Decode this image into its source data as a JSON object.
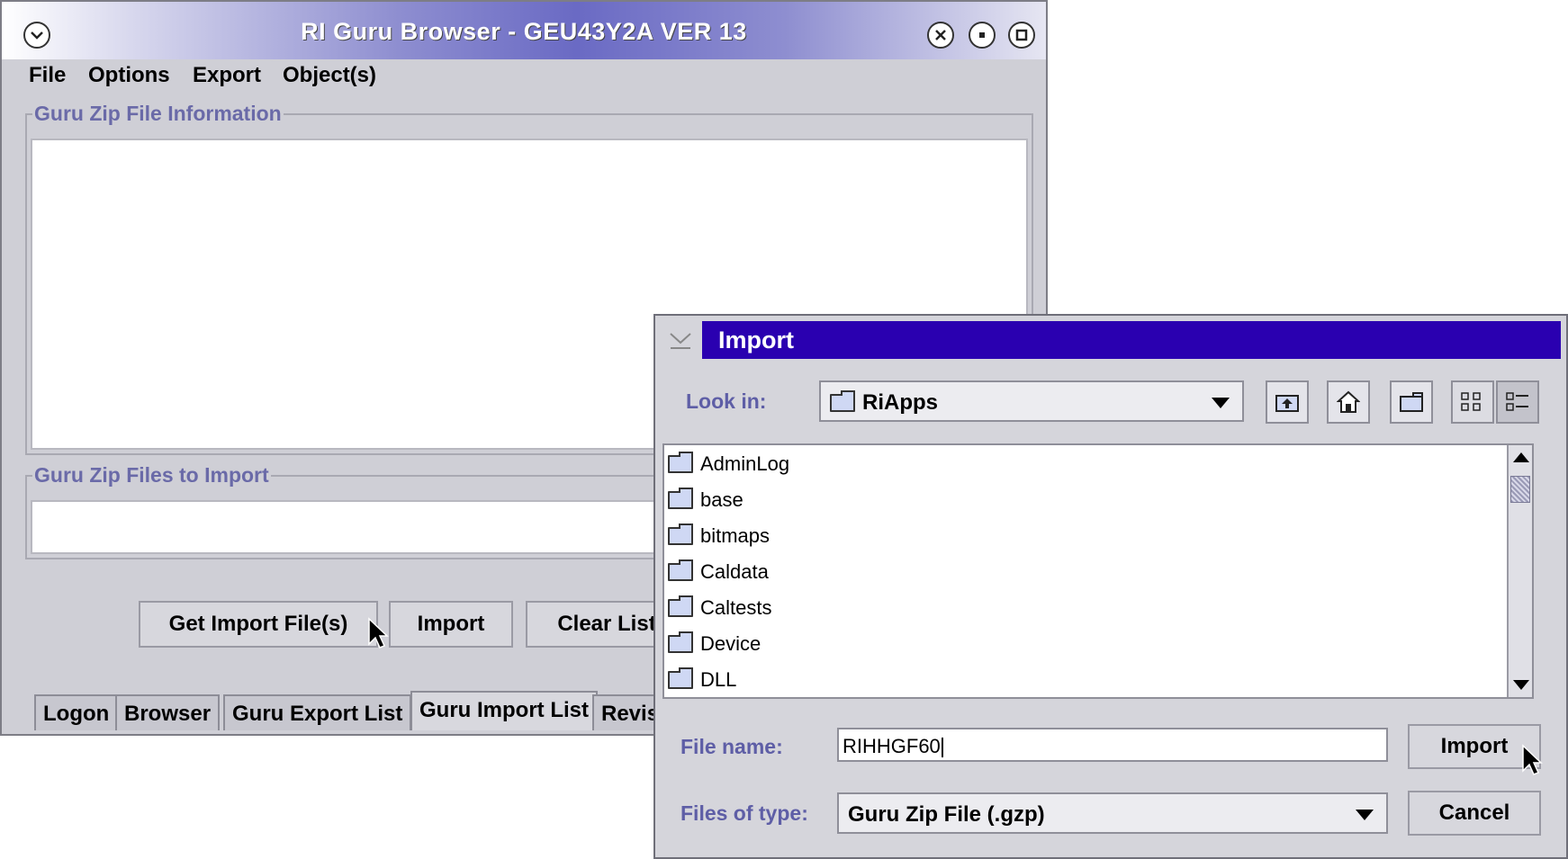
{
  "main_window": {
    "title": "RI Guru Browser - GEU43Y2A  VER 13",
    "menu": [
      "File",
      "Options",
      "Export",
      "Object(s)"
    ],
    "group_info_title": "Guru Zip File Information",
    "group_files_title": "Guru Zip Files to Import",
    "buttons": {
      "get_import": "Get Import File(s)",
      "import": "Import",
      "clear_list": "Clear List"
    },
    "tabs": [
      "Logon",
      "Browser",
      "Guru Export List",
      "Guru Import List",
      "Revis"
    ],
    "active_tab": "Guru Import List"
  },
  "import_dialog": {
    "title": "Import",
    "look_in_label": "Look in:",
    "look_in_value": "RiApps",
    "files": [
      "AdminLog",
      "base",
      "bitmaps",
      "Caldata",
      "Caltests",
      "Device",
      "DLL"
    ],
    "file_name_label": "File name:",
    "file_name_value": "RIHHGF60",
    "files_of_type_label": "Files of type:",
    "files_of_type_value": "Guru Zip File (.gzp)",
    "import_button": "Import",
    "cancel_button": "Cancel"
  },
  "icons": {
    "window_menu": "chevron-down-circle-icon",
    "close": "close-circle-icon",
    "minimize": "minimize-circle-icon",
    "maximize": "maximize-circle-icon",
    "up_folder": "up-folder-icon",
    "home": "home-icon",
    "new_folder": "new-folder-icon",
    "list_view": "list-view-icon",
    "details_view": "details-view-icon"
  },
  "colors": {
    "dialog_title_bar": "#2a00b0",
    "label_text": "#5e5ea6"
  }
}
